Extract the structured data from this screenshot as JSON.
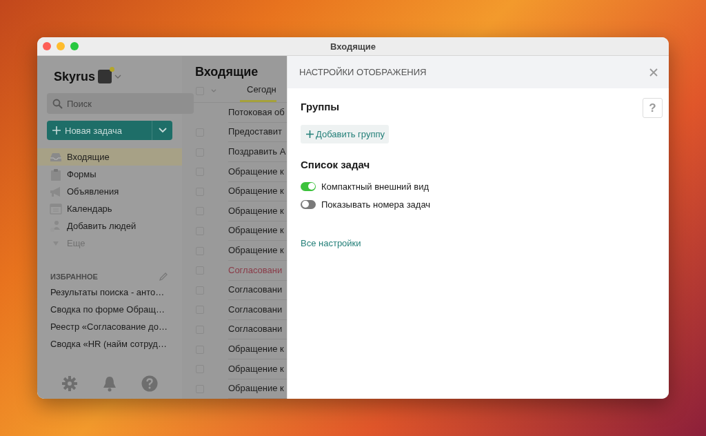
{
  "window": {
    "title": "Входящие"
  },
  "sidebar": {
    "brand": "Skyrus",
    "search": {
      "placeholder": "Поиск"
    },
    "new_task": "Новая задача",
    "items": [
      {
        "label": "Входящие",
        "selected": true
      },
      {
        "label": "Формы",
        "selected": false
      },
      {
        "label": "Объявления",
        "selected": false
      },
      {
        "label": "Календарь",
        "selected": false
      },
      {
        "label": "Добавить людей",
        "selected": false
      }
    ],
    "more": "Еще",
    "favorites": {
      "heading": "ИЗБРАННОЕ",
      "items": [
        "Результаты поиска - анто…",
        "Сводка по форме Обращ…",
        "Реестр «Согласование до…",
        "Сводка «HR (найм сотруд…"
      ]
    }
  },
  "task_list": {
    "title": "Входящие",
    "select_all": {
      "checked": false
    },
    "tabs": [
      {
        "label": "Сегодн",
        "selected": true
      }
    ],
    "rows": [
      {
        "text": "Потоковая об",
        "kind": "plain",
        "overdue": false
      },
      {
        "text": "Предоставит",
        "kind": "checkbox",
        "checked": false,
        "overdue": false
      },
      {
        "text": "Поздравить А",
        "kind": "checkbox",
        "checked": false,
        "overdue": false
      },
      {
        "text": "Обращение к",
        "kind": "checkbox",
        "checked": false,
        "overdue": false
      },
      {
        "text": "Обращение к",
        "kind": "checkbox",
        "checked": false,
        "overdue": false
      },
      {
        "text": "Обращение к",
        "kind": "checkbox",
        "checked": false,
        "overdue": false
      },
      {
        "text": "Обращение к",
        "kind": "checkbox",
        "checked": false,
        "overdue": false
      },
      {
        "text": "Обращение к",
        "kind": "checkbox",
        "checked": false,
        "overdue": false
      },
      {
        "text": "Согласовани",
        "kind": "checkbox",
        "checked": false,
        "overdue": true
      },
      {
        "text": "Согласовани",
        "kind": "checkbox",
        "checked": false,
        "overdue": false
      },
      {
        "text": "Согласовани",
        "kind": "checkbox",
        "checked": false,
        "overdue": false
      },
      {
        "text": "Согласовани",
        "kind": "checkbox",
        "checked": false,
        "overdue": false
      },
      {
        "text": "Обращение к",
        "kind": "checkbox",
        "checked": false,
        "overdue": false
      },
      {
        "text": "Обращение к",
        "kind": "checkbox",
        "checked": false,
        "overdue": false
      },
      {
        "text": "Обращение к",
        "kind": "checkbox",
        "checked": false,
        "overdue": false
      }
    ]
  },
  "settings_panel": {
    "title": "НАСТРОЙКИ ОТОБРАЖЕНИЯ",
    "help": "?",
    "groups_heading": "Группы",
    "add_group": "Добавить группу",
    "task_list_heading": "Список задач",
    "toggles": [
      {
        "label": "Компактный внешний вид",
        "on": true
      },
      {
        "label": "Показывать номера задач",
        "on": false
      }
    ],
    "all_settings": "Все настройки"
  }
}
